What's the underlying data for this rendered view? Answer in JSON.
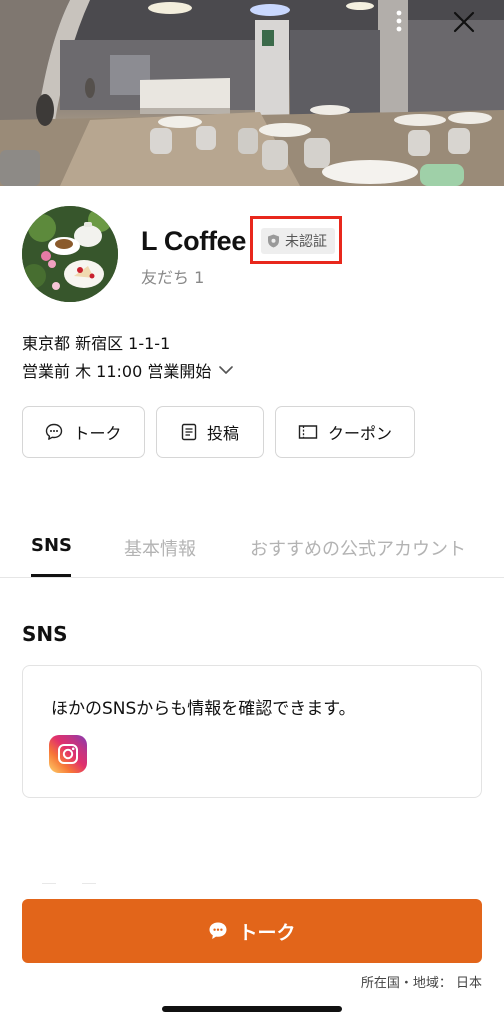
{
  "account": {
    "name": "L Coffee",
    "badge_label": "未認証",
    "friends_label": "友だち 1"
  },
  "cover": {
    "more_icon": "more-vertical-icon",
    "close_icon": "close-icon"
  },
  "info": {
    "address": "東京都 新宿区 1-1-1",
    "hours": "営業前 木 11:00 営業開始"
  },
  "actions": [
    {
      "label": "トーク",
      "icon": "chat-bubble-icon"
    },
    {
      "label": "投稿",
      "icon": "document-icon"
    },
    {
      "label": "クーポン",
      "icon": "coupon-icon"
    }
  ],
  "tabs": [
    {
      "label": "SNS",
      "active": true
    },
    {
      "label": "基本情報",
      "active": false
    },
    {
      "label": "おすすめの公式アカウント",
      "active": false
    }
  ],
  "sns": {
    "title": "SNS",
    "description": "ほかのSNSからも情報を確認できます。",
    "services": [
      "instagram-icon"
    ]
  },
  "footer": {
    "cta_label": "トーク",
    "region": "所在国・地域： 日本"
  },
  "colors": {
    "accent": "#e2651a",
    "highlight_box": "#e8281c",
    "inactive_tab": "#b3b3b3"
  }
}
